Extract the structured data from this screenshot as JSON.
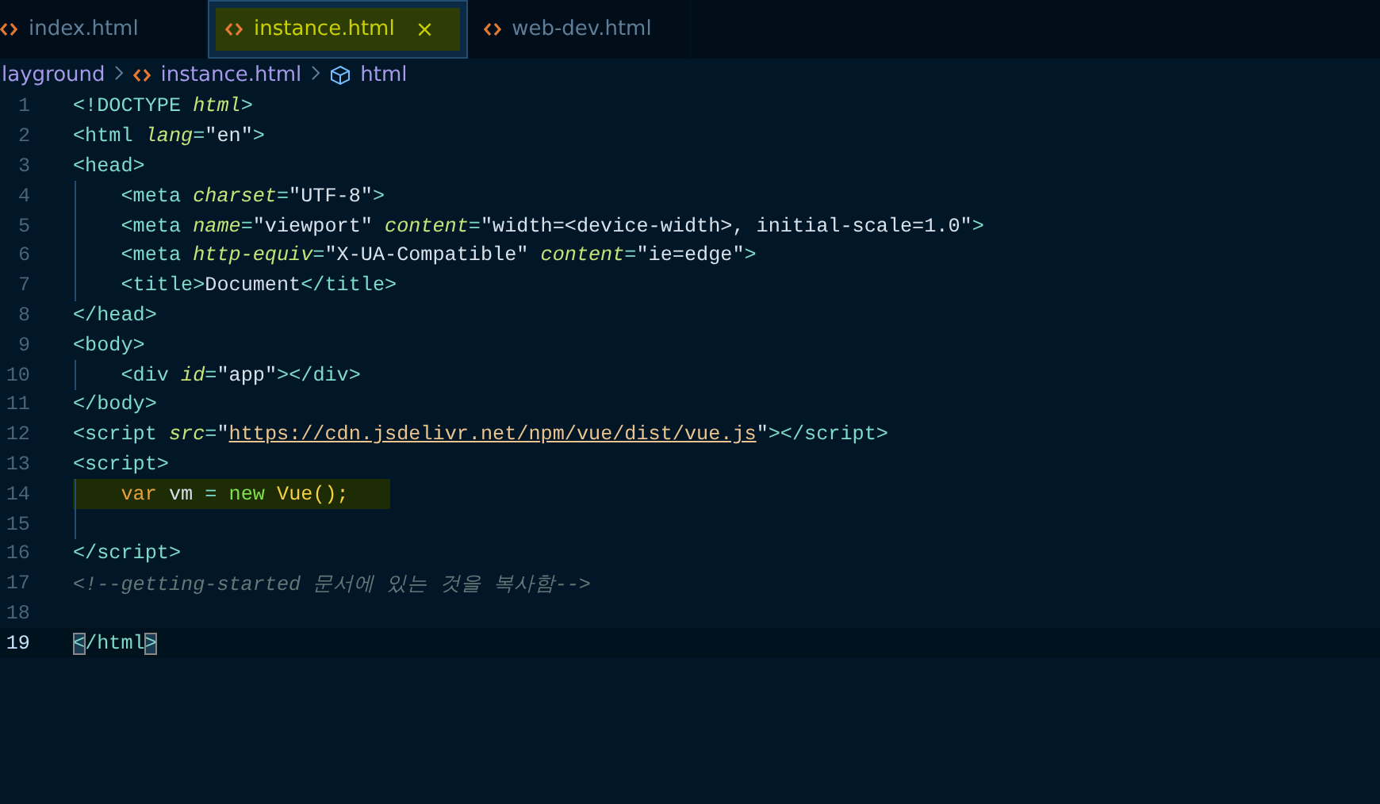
{
  "tabs": [
    {
      "label": "index.html",
      "selected": false,
      "highlighted": false
    },
    {
      "label": "instance.html",
      "selected": true,
      "highlighted": true,
      "close": "×"
    },
    {
      "label": "web-dev.html",
      "selected": false,
      "highlighted": false
    }
  ],
  "breadcrumb": [
    {
      "label": "layground",
      "kind": "folder"
    },
    {
      "label": "instance.html",
      "kind": "file"
    },
    {
      "label": "html",
      "kind": "symbol"
    }
  ],
  "lines": [
    {
      "number": "1",
      "current": false,
      "highlighted": false,
      "tokens": [
        {
          "kind": "tag",
          "text": "<!DOCTYPE "
        },
        {
          "kind": "attr",
          "text": "html"
        },
        {
          "kind": "tag",
          "text": ">"
        }
      ]
    },
    {
      "number": "2",
      "current": false,
      "highlighted": false,
      "tokens": [
        {
          "kind": "tag",
          "text": "<html "
        },
        {
          "kind": "attr",
          "text": "lang"
        },
        {
          "kind": "tag",
          "text": "="
        },
        {
          "kind": "string",
          "text": "\"en\""
        },
        {
          "kind": "tag",
          "text": ">"
        }
      ]
    },
    {
      "number": "3",
      "current": false,
      "highlighted": false,
      "tokens": [
        {
          "kind": "tag",
          "text": "<head>"
        }
      ]
    },
    {
      "number": "4",
      "current": false,
      "highlighted": false,
      "tokens": [
        {
          "kind": "tag",
          "text": "    <meta "
        },
        {
          "kind": "attr",
          "text": "charset"
        },
        {
          "kind": "tag",
          "text": "="
        },
        {
          "kind": "string",
          "text": "\"UTF-8\""
        },
        {
          "kind": "tag",
          "text": ">"
        }
      ]
    },
    {
      "number": "5",
      "current": false,
      "highlighted": false,
      "tokens": [
        {
          "kind": "tag",
          "text": "    <meta "
        },
        {
          "kind": "attr",
          "text": "name"
        },
        {
          "kind": "tag",
          "text": "="
        },
        {
          "kind": "string",
          "text": "\"viewport\" "
        },
        {
          "kind": "attr",
          "text": "content"
        },
        {
          "kind": "tag",
          "text": "="
        },
        {
          "kind": "string",
          "text": "\"width=<device-width>, initial-scale=1.0\""
        },
        {
          "kind": "tag",
          "text": ">"
        }
      ]
    },
    {
      "number": "6",
      "current": false,
      "highlighted": false,
      "tokens": [
        {
          "kind": "tag",
          "text": "    <meta "
        },
        {
          "kind": "attr",
          "text": "http-equiv"
        },
        {
          "kind": "tag",
          "text": "="
        },
        {
          "kind": "string",
          "text": "\"X-UA-Compatible\" "
        },
        {
          "kind": "attr",
          "text": "content"
        },
        {
          "kind": "tag",
          "text": "="
        },
        {
          "kind": "string",
          "text": "\"ie=edge\""
        },
        {
          "kind": "tag",
          "text": ">"
        }
      ]
    },
    {
      "number": "7",
      "current": false,
      "highlighted": false,
      "tokens": [
        {
          "kind": "tag",
          "text": "    <title>"
        },
        {
          "kind": "plain",
          "text": "Document"
        },
        {
          "kind": "tag",
          "text": "</title>"
        }
      ]
    },
    {
      "number": "8",
      "current": false,
      "highlighted": false,
      "tokens": [
        {
          "kind": "tag",
          "text": "</head>"
        }
      ]
    },
    {
      "number": "9",
      "current": false,
      "highlighted": false,
      "tokens": [
        {
          "kind": "tag",
          "text": "<body>"
        }
      ]
    },
    {
      "number": "10",
      "current": false,
      "highlighted": false,
      "tokens": [
        {
          "kind": "tag",
          "text": "    <div "
        },
        {
          "kind": "attr",
          "text": "id"
        },
        {
          "kind": "tag",
          "text": "="
        },
        {
          "kind": "string",
          "text": "\"app\""
        },
        {
          "kind": "tag",
          "text": "></div>"
        }
      ]
    },
    {
      "number": "11",
      "current": false,
      "highlighted": false,
      "tokens": [
        {
          "kind": "tag",
          "text": "</body>"
        }
      ]
    },
    {
      "number": "12",
      "current": false,
      "highlighted": false,
      "tokens": [
        {
          "kind": "tag",
          "text": "<script "
        },
        {
          "kind": "attr",
          "text": "src"
        },
        {
          "kind": "tag",
          "text": "="
        },
        {
          "kind": "string",
          "text": "\""
        },
        {
          "kind": "link",
          "text": "https://cdn.jsdelivr.net/npm/vue/dist/vue.js"
        },
        {
          "kind": "string",
          "text": "\""
        },
        {
          "kind": "tag",
          "text": "></script>"
        }
      ]
    },
    {
      "number": "13",
      "current": false,
      "highlighted": false,
      "tokens": [
        {
          "kind": "tag",
          "text": "<script>"
        }
      ]
    },
    {
      "number": "14",
      "current": false,
      "highlighted": true,
      "tokens": [
        {
          "kind": "keyword",
          "text": "    var "
        },
        {
          "kind": "plain",
          "text": "vm "
        },
        {
          "kind": "operator",
          "text": "= "
        },
        {
          "kind": "new",
          "text": "new "
        },
        {
          "kind": "call",
          "text": "Vue();"
        }
      ]
    },
    {
      "number": "15",
      "current": false,
      "highlighted": false,
      "guide": true
    },
    {
      "number": "16",
      "current": false,
      "highlighted": false,
      "tokens": [
        {
          "kind": "tag",
          "text": "</script>"
        }
      ]
    },
    {
      "number": "17",
      "current": false,
      "highlighted": false,
      "tokens": [
        {
          "kind": "comment",
          "text": "<!--getting-started 문서에 있는 것을 복사함-->"
        }
      ]
    },
    {
      "number": "18",
      "current": false,
      "highlighted": false
    },
    {
      "number": "19",
      "current": true,
      "highlighted": false,
      "tokens": [
        {
          "kind": "match",
          "text": "<"
        },
        {
          "kind": "tag",
          "text": "/html"
        },
        {
          "kind": "match",
          "text": ">"
        }
      ]
    }
  ]
}
